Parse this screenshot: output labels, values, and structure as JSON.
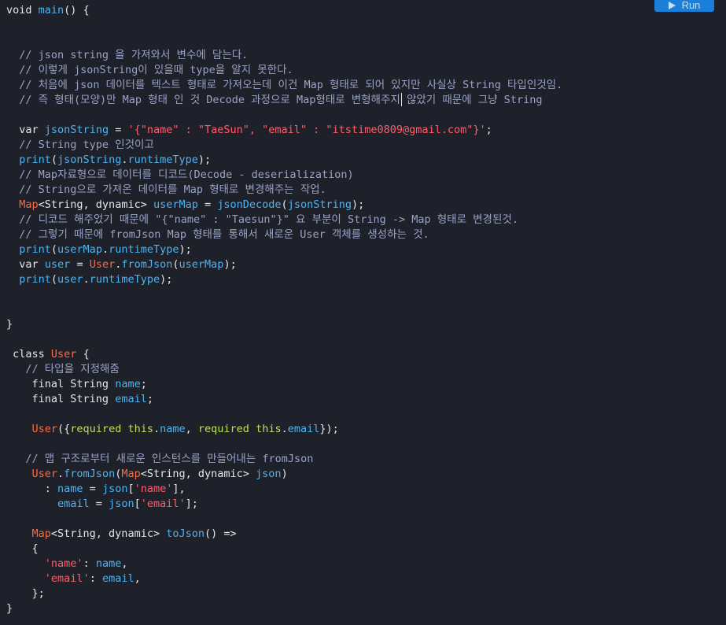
{
  "toolbar": {
    "run_label": "Run",
    "run_icon": "play-icon"
  },
  "colors": {
    "background": "#1e2129",
    "plain": "#e6e6e6",
    "function": "#4fb3f0",
    "comment": "#9aa3c7",
    "string": "#ff5c6c",
    "type": "#ff6a3d",
    "this_keyword": "#b9e05a",
    "run_button": "#1a7fd9"
  },
  "code": {
    "lines": [
      {
        "text": "void main() {",
        "tokens": [
          [
            "kw",
            "void"
          ],
          [
            "plain",
            " "
          ],
          [
            "fn",
            "main"
          ],
          [
            "plain",
            "() {"
          ]
        ]
      },
      {
        "text": "",
        "tokens": []
      },
      {
        "text": "",
        "tokens": []
      },
      {
        "text": "  // json string 을 가져와서 변수에 담는다.",
        "tokens": [
          [
            "comment",
            "  // json string 을 가져와서 변수에 담는다."
          ]
        ]
      },
      {
        "text": "  // 이렇게 jsonString이 있을때 type을 알지 못한다.",
        "tokens": [
          [
            "comment",
            "  // 이렇게 jsonString이 있을때 type을 알지 못한다."
          ]
        ]
      },
      {
        "text": "  // 처음에 json 데이터를 텍스트 형태로 가져오는데 이건 Map 형태로 되어 있지만 사실상 String 타입인것임.",
        "tokens": [
          [
            "comment",
            "  // 처음에 json 데이터를 텍스트 형태로 가져오는데 이건 Map 형태로 되어 있지만 사실상 String 타입인것임."
          ]
        ]
      },
      {
        "text": "  // 즉 형태(모양)만 Map 형태 인 것 Decode 과정으로 Map형태로 변형해주지 않았기 때문에 그냥 String",
        "tokens": [
          [
            "comment",
            "  // 즉 형태(모양)만 Map 형태 인 것 Decode 과정으로 Map형태로 변형해주지 않았기 때문에 그냥 String"
          ]
        ]
      },
      {
        "text": "",
        "tokens": []
      },
      {
        "text": "  var jsonString = '{\"name\" : \"TaeSun\", \"email\" : \"itstime0809@gmail.com\"}';",
        "tokens": [
          [
            "plain",
            "  "
          ],
          [
            "kw",
            "var"
          ],
          [
            "plain",
            " "
          ],
          [
            "fn",
            "jsonString"
          ],
          [
            "plain",
            " = "
          ],
          [
            "string",
            "'{\"name\" : \"TaeSun\", \"email\" : \"itstime0809@gmail.com\"}'"
          ],
          [
            "plain",
            ";"
          ]
        ]
      },
      {
        "text": "  // String type 인것이고",
        "tokens": [
          [
            "comment",
            "  // String type 인것이고"
          ]
        ]
      },
      {
        "text": "  print(jsonString.runtimeType);",
        "tokens": [
          [
            "plain",
            "  "
          ],
          [
            "fn",
            "print"
          ],
          [
            "plain",
            "("
          ],
          [
            "fn",
            "jsonString"
          ],
          [
            "plain",
            "."
          ],
          [
            "fn",
            "runtimeType"
          ],
          [
            "plain",
            ");"
          ]
        ]
      },
      {
        "text": "  // Map자료형으로 데이터를 디코드(Decode - deserialization)",
        "tokens": [
          [
            "comment",
            "  // Map자료형으로 데이터를 디코드(Decode - deserialization)"
          ]
        ]
      },
      {
        "text": "  // String으로 가져온 데이터를 Map 형태로 변경해주는 작업.",
        "tokens": [
          [
            "comment",
            "  // String으로 가져온 데이터를 Map 형태로 변경해주는 작업."
          ]
        ]
      },
      {
        "text": "  Map<String, dynamic> userMap = jsonDecode(jsonString);",
        "tokens": [
          [
            "plain",
            "  "
          ],
          [
            "type",
            "Map"
          ],
          [
            "plain",
            "<String, dynamic> "
          ],
          [
            "fn",
            "userMap"
          ],
          [
            "plain",
            " = "
          ],
          [
            "fn",
            "jsonDecode"
          ],
          [
            "plain",
            "("
          ],
          [
            "fn",
            "jsonString"
          ],
          [
            "plain",
            ");"
          ]
        ]
      },
      {
        "text": "  // 디코드 해주었기 때문에 \"{\"name\" : \"Taesun\"}\" 요 부분이 String -> Map 형태로 변경된것.",
        "tokens": [
          [
            "comment",
            "  // 디코드 해주었기 때문에 \"{\"name\" : \"Taesun\"}\" 요 부분이 String -> Map 형태로 변경된것."
          ]
        ]
      },
      {
        "text": "  // 그렇기 때문에 fromJson Map 형태를 통해서 새로운 User 객체를 생성하는 것.",
        "tokens": [
          [
            "comment",
            "  // 그렇기 때문에 fromJson Map 형태를 통해서 새로운 User 객체를 생성하는 것."
          ]
        ]
      },
      {
        "text": "  print(userMap.runtimeType);",
        "tokens": [
          [
            "plain",
            "  "
          ],
          [
            "fn",
            "print"
          ],
          [
            "plain",
            "("
          ],
          [
            "fn",
            "userMap"
          ],
          [
            "plain",
            "."
          ],
          [
            "fn",
            "runtimeType"
          ],
          [
            "plain",
            ");"
          ]
        ]
      },
      {
        "text": "  var user = User.fromJson(userMap);",
        "tokens": [
          [
            "plain",
            "  "
          ],
          [
            "kw",
            "var"
          ],
          [
            "plain",
            " "
          ],
          [
            "fn",
            "user"
          ],
          [
            "plain",
            " = "
          ],
          [
            "type",
            "User"
          ],
          [
            "plain",
            "."
          ],
          [
            "fn",
            "fromJson"
          ],
          [
            "plain",
            "("
          ],
          [
            "fn",
            "userMap"
          ],
          [
            "plain",
            ");"
          ]
        ]
      },
      {
        "text": "  print(user.runtimeType);",
        "tokens": [
          [
            "plain",
            "  "
          ],
          [
            "fn",
            "print"
          ],
          [
            "plain",
            "("
          ],
          [
            "fn",
            "user"
          ],
          [
            "plain",
            "."
          ],
          [
            "fn",
            "runtimeType"
          ],
          [
            "plain",
            ");"
          ]
        ]
      },
      {
        "text": "",
        "tokens": []
      },
      {
        "text": "",
        "tokens": []
      },
      {
        "text": "}",
        "tokens": [
          [
            "plain",
            "}"
          ]
        ]
      },
      {
        "text": "",
        "tokens": []
      },
      {
        "text": " class User {",
        "tokens": [
          [
            "plain",
            " "
          ],
          [
            "kw",
            "class"
          ],
          [
            "plain",
            " "
          ],
          [
            "type",
            "User"
          ],
          [
            "plain",
            " {"
          ]
        ]
      },
      {
        "text": "   // 타입을 지정해줌",
        "tokens": [
          [
            "comment",
            "   // 타입을 지정해줌"
          ]
        ]
      },
      {
        "text": "    final String name;",
        "tokens": [
          [
            "plain",
            "    "
          ],
          [
            "kw",
            "final"
          ],
          [
            "plain",
            " String "
          ],
          [
            "fn",
            "name"
          ],
          [
            "plain",
            ";"
          ]
        ]
      },
      {
        "text": "    final String email;",
        "tokens": [
          [
            "plain",
            "    "
          ],
          [
            "kw",
            "final"
          ],
          [
            "plain",
            " String "
          ],
          [
            "fn",
            "email"
          ],
          [
            "plain",
            ";"
          ]
        ]
      },
      {
        "text": "",
        "tokens": []
      },
      {
        "text": "    User({required this.name, required this.email});",
        "tokens": [
          [
            "plain",
            "    "
          ],
          [
            "type",
            "User"
          ],
          [
            "plain",
            "({"
          ],
          [
            "this",
            "required"
          ],
          [
            "plain",
            " "
          ],
          [
            "this",
            "this"
          ],
          [
            "plain",
            "."
          ],
          [
            "fn",
            "name"
          ],
          [
            "plain",
            ", "
          ],
          [
            "this",
            "required"
          ],
          [
            "plain",
            " "
          ],
          [
            "this",
            "this"
          ],
          [
            "plain",
            "."
          ],
          [
            "fn",
            "email"
          ],
          [
            "plain",
            "});"
          ]
        ]
      },
      {
        "text": "",
        "tokens": []
      },
      {
        "text": "   // 맵 구조로부터 새로운 인스턴스를 만들어내는 fromJson",
        "tokens": [
          [
            "comment",
            "   // 맵 구조로부터 새로운 인스턴스를 만들어내는 fromJson"
          ]
        ]
      },
      {
        "text": "    User.fromJson(Map<String, dynamic> json)",
        "tokens": [
          [
            "plain",
            "    "
          ],
          [
            "type",
            "User"
          ],
          [
            "plain",
            "."
          ],
          [
            "fn",
            "fromJson"
          ],
          [
            "plain",
            "("
          ],
          [
            "type",
            "Map"
          ],
          [
            "plain",
            "<String, dynamic> "
          ],
          [
            "fn",
            "json"
          ],
          [
            "plain",
            ")"
          ]
        ]
      },
      {
        "text": "      : name = json['name'],",
        "tokens": [
          [
            "plain",
            "      : "
          ],
          [
            "fn",
            "name"
          ],
          [
            "plain",
            " = "
          ],
          [
            "fn",
            "json"
          ],
          [
            "plain",
            "["
          ],
          [
            "string",
            "'name'"
          ],
          [
            "plain",
            "],"
          ]
        ]
      },
      {
        "text": "        email = json['email'];",
        "tokens": [
          [
            "plain",
            "        "
          ],
          [
            "fn",
            "email"
          ],
          [
            "plain",
            " = "
          ],
          [
            "fn",
            "json"
          ],
          [
            "plain",
            "["
          ],
          [
            "string",
            "'email'"
          ],
          [
            "plain",
            "];"
          ]
        ]
      },
      {
        "text": "",
        "tokens": []
      },
      {
        "text": "    Map<String, dynamic> toJson() =>",
        "tokens": [
          [
            "plain",
            "    "
          ],
          [
            "type",
            "Map"
          ],
          [
            "plain",
            "<String, dynamic> "
          ],
          [
            "fn",
            "toJson"
          ],
          [
            "plain",
            "() =>"
          ]
        ]
      },
      {
        "text": "    {",
        "tokens": [
          [
            "plain",
            "    {"
          ]
        ]
      },
      {
        "text": "      'name': name,",
        "tokens": [
          [
            "plain",
            "      "
          ],
          [
            "string",
            "'name'"
          ],
          [
            "plain",
            ": "
          ],
          [
            "fn",
            "name"
          ],
          [
            "plain",
            ","
          ]
        ]
      },
      {
        "text": "      'email': email,",
        "tokens": [
          [
            "plain",
            "      "
          ],
          [
            "string",
            "'email'"
          ],
          [
            "plain",
            ": "
          ],
          [
            "fn",
            "email"
          ],
          [
            "plain",
            ","
          ]
        ]
      },
      {
        "text": "    };",
        "tokens": [
          [
            "plain",
            "    };"
          ]
        ]
      },
      {
        "text": "}",
        "tokens": [
          [
            "plain",
            "}"
          ]
        ]
      }
    ]
  }
}
